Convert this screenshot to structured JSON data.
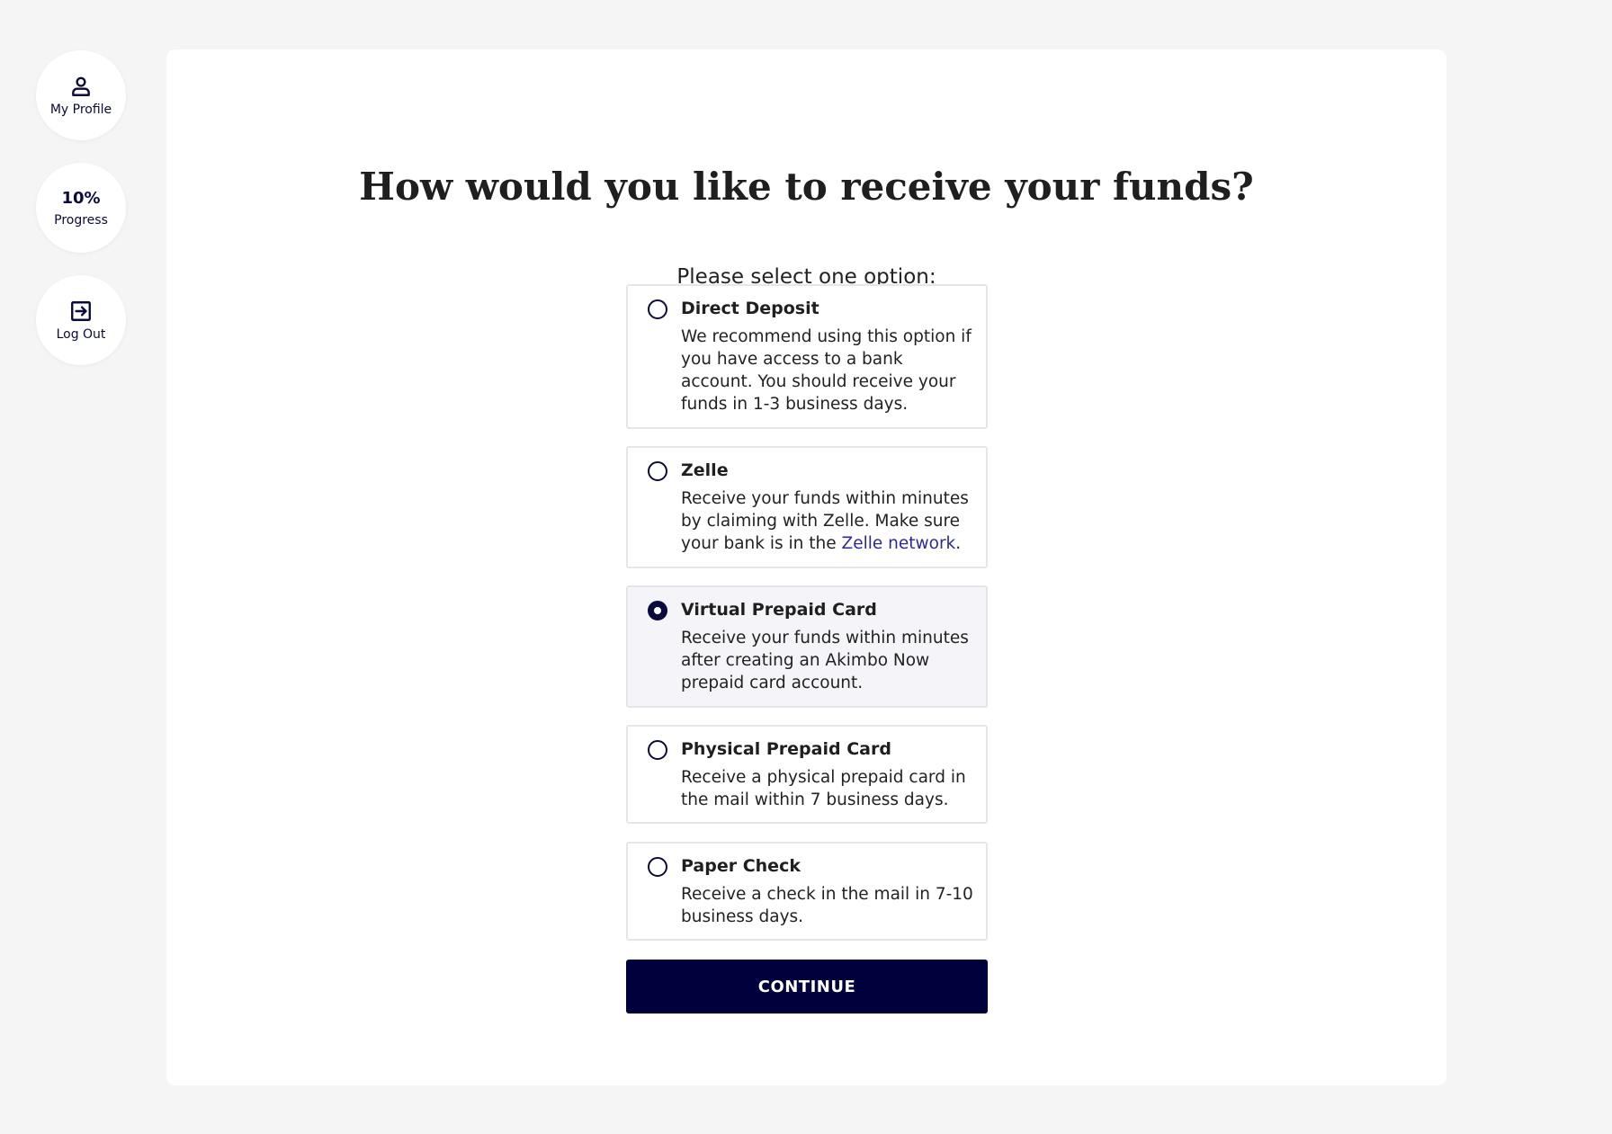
{
  "sidebar": {
    "profile": {
      "label": "My Profile",
      "icon": "person-icon"
    },
    "progress": {
      "value": "10%",
      "label": "Progress"
    },
    "logout": {
      "label": "Log Out",
      "icon": "logout-icon"
    }
  },
  "main": {
    "title": "How would you like to receive your funds?",
    "subtitle": "Please select one option:",
    "options": [
      {
        "title": "Direct Deposit",
        "description": "We recommend using this option if you have access to a bank account. You should receive your funds in 1-3 business days.",
        "selected": false
      },
      {
        "title": "Zelle",
        "description_before_link": "Receive your funds within minutes by claiming with Zelle. Make sure your bank is in the ",
        "link_text": "Zelle network",
        "description_after_link": ".",
        "selected": false
      },
      {
        "title": "Virtual Prepaid Card",
        "description": "Receive your funds within minutes after creating an Akimbo Now prepaid card account.",
        "selected": true
      },
      {
        "title": "Physical Prepaid Card",
        "description": "Receive a physical prepaid card in the mail within 7 business days.",
        "selected": false
      },
      {
        "title": "Paper Check",
        "description": "Receive a check in the mail in 7-10 business days.",
        "selected": false
      }
    ],
    "continue_label": "CONTINUE"
  },
  "colors": {
    "accent": "#00003c",
    "link": "#2a2a9a",
    "background": "#f5f5f5",
    "selected_option_bg": "#f4f4f9"
  }
}
